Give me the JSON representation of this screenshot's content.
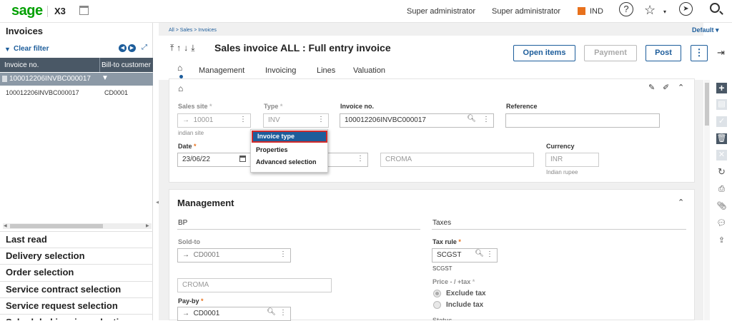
{
  "topbar": {
    "logo": "sage",
    "product": "X3",
    "user1": "Super administrator",
    "user2": "Super administrator",
    "folder": "IND",
    "icons": [
      "calendar-icon",
      "help-icon",
      "star-icon",
      "compass-icon",
      "search-icon"
    ],
    "folder_color": "#e8711c"
  },
  "left": {
    "title": "Invoices",
    "clear_filter": "Clear filter",
    "columns": [
      "Invoice no.",
      "Bill-to customer"
    ],
    "rows": [
      {
        "c1": "100012206INVBC000017",
        "c2": ""
      },
      {
        "c1": "100012206INVBC000017",
        "c2": "CD0001"
      }
    ],
    "sections": [
      "Last read",
      "Delivery selection",
      "Order selection",
      "Service contract selection",
      "Service request selection",
      "Scheduled invoice selection"
    ]
  },
  "main": {
    "breadcrumb": "All  >  Sales  >  Invoices",
    "default_label": "Default",
    "title": "Sales invoice ALL : Full entry invoice",
    "buttons": {
      "open_items": "Open items",
      "payment": "Payment",
      "post": "Post",
      "more": "⋮"
    },
    "tabs": [
      "Management",
      "Invoicing",
      "Lines",
      "Valuation"
    ]
  },
  "card1": {
    "sales_site_label": "Sales site",
    "sales_site_value": "10001",
    "sales_site_desc": "indian site",
    "type_label": "Type",
    "type_value": "INV",
    "invoice_no_label": "Invoice no.",
    "invoice_no_value": "100012206INVBC000017",
    "reference_label": "Reference",
    "reference_value": "",
    "date_label": "Date",
    "date_value": "23/06/22",
    "customer_name": "CROMA",
    "currency_label": "Currency",
    "currency_value": "INR",
    "currency_desc": "Indian rupee"
  },
  "context_menu": [
    "Invoice type",
    "Properties",
    "Advanced selection"
  ],
  "management": {
    "title": "Management",
    "bp_title": "BP",
    "taxes_title": "Taxes",
    "sold_to_label": "Sold-to",
    "sold_to_value": "CD0001",
    "sold_to_name": "CROMA",
    "pay_by_label": "Pay-by",
    "pay_by_value": "CD0001",
    "tax_rule_label": "Tax rule",
    "tax_rule_value": "SCGST",
    "tax_rule_desc": "SCGST",
    "price_label": "Price - / +tax",
    "radio1": "Exclude tax",
    "radio2": "Include tax",
    "status_label": "Status"
  }
}
